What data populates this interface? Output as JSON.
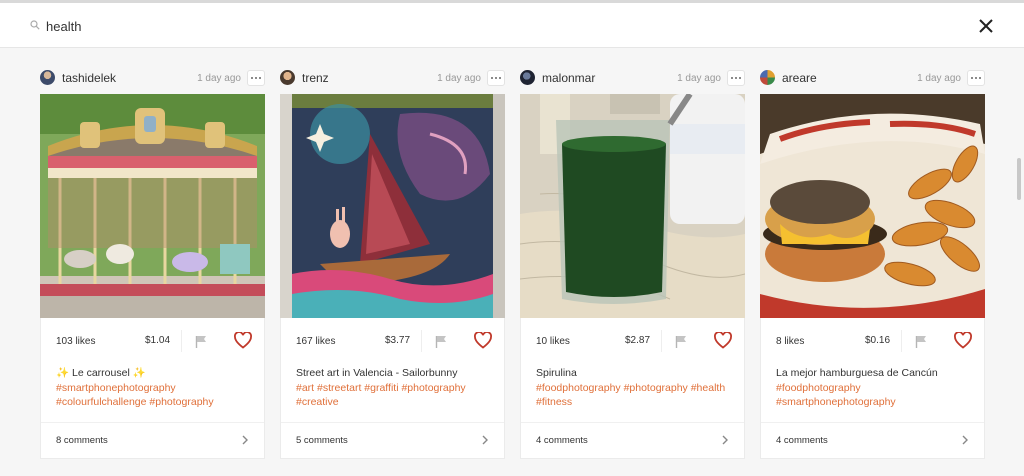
{
  "search": {
    "query": "health",
    "placeholder": ""
  },
  "posts": [
    {
      "username": "tashidelek",
      "time": "1 day ago",
      "likes": "103 likes",
      "price": "$1.04",
      "caption": "✨ Le carrousel ✨",
      "tags": "#smartphonephotography #colourfulchallenge #photography",
      "comments": "8 comments"
    },
    {
      "username": "trenz",
      "time": "1 day ago",
      "likes": "167 likes",
      "price": "$3.77",
      "caption": "Street art in Valencia - Sailorbunny",
      "tags": "#art #streetart #graffiti #photography #creative",
      "comments": "5 comments"
    },
    {
      "username": "malonmar",
      "time": "1 day ago",
      "likes": "10 likes",
      "price": "$2.87",
      "caption": "Spirulina",
      "tags": "#foodphotography #photography #health #fitness",
      "comments": "4 comments"
    },
    {
      "username": "areare",
      "time": "1 day ago",
      "likes": "8 likes",
      "price": "$0.16",
      "caption": "La mejor hamburguesa de Cancún",
      "tags": "#foodphotography #smartphonephotography",
      "comments": "4 comments"
    }
  ],
  "colors": {
    "accent": "#c0392b",
    "tag": "#e0703a"
  },
  "icons": [
    "search-icon",
    "close-icon",
    "more-icon",
    "flag-icon",
    "heart-icon",
    "chevron-right-icon"
  ]
}
